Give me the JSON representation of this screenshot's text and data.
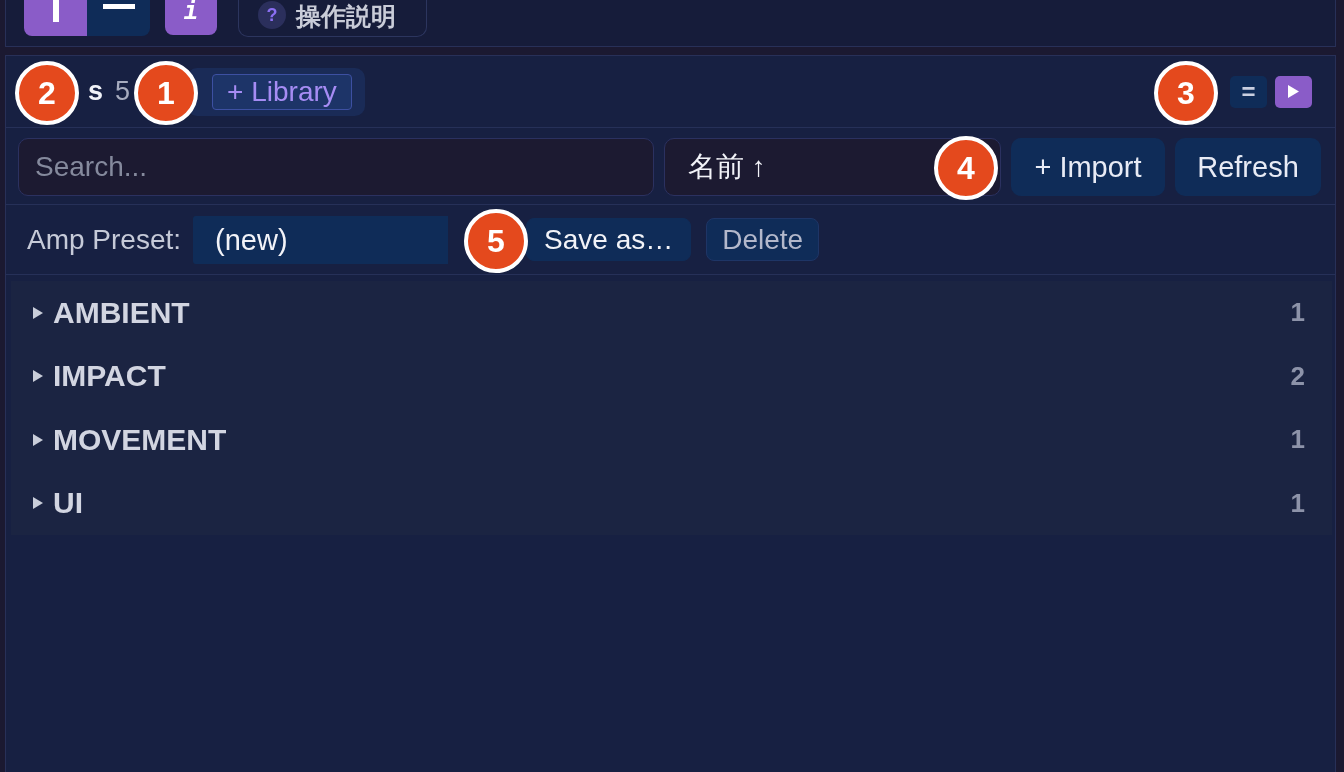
{
  "toolbar": {
    "view_toggle": [
      {
        "kind": "vertical",
        "selected": true
      },
      {
        "kind": "horizontal",
        "selected": false
      }
    ],
    "info_button": {
      "label": "i"
    },
    "help_button": {
      "icon": "?",
      "label": "操作説明"
    }
  },
  "library_panel": {
    "title": "s",
    "count": "5",
    "library_button": "+ Library",
    "header_buttons": [
      {
        "kind": "text",
        "label": "=",
        "active": false
      },
      {
        "kind": "play",
        "active": true
      }
    ],
    "search": {
      "placeholder": "Search..."
    },
    "sort": {
      "value": "名前 ↑"
    },
    "actions": [
      "+ Import",
      "Refresh"
    ],
    "preset": {
      "label": "Amp Preset:",
      "value": "(new)",
      "buttons": [
        {
          "label": "Save as…",
          "disabled": false
        },
        {
          "label": "Delete",
          "disabled": true
        }
      ]
    },
    "groups": [
      {
        "name": "AMBIENT",
        "count": "1",
        "expanded": false
      },
      {
        "name": "IMPACT",
        "count": "2",
        "expanded": false
      },
      {
        "name": "MOVEMENT",
        "count": "1",
        "expanded": false
      },
      {
        "name": "UI",
        "count": "1",
        "expanded": false
      }
    ]
  },
  "callouts": [
    {
      "label": "2"
    },
    {
      "label": "1"
    },
    {
      "label": "3"
    },
    {
      "label": "4"
    },
    {
      "label": "5"
    }
  ]
}
